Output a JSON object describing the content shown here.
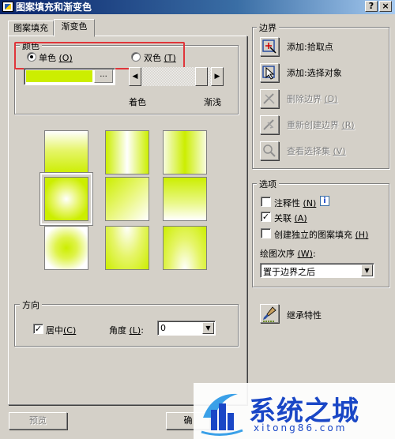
{
  "window": {
    "title": "图案填充和渐变色",
    "help_btn": "?",
    "close_btn": "×"
  },
  "tabs": [
    {
      "label": "图案填充"
    },
    {
      "label": "渐变色"
    }
  ],
  "color_group": {
    "title": "颜色",
    "single_label": "单色",
    "single_key": "(O)",
    "double_label": "双色",
    "double_key": "(T)",
    "swatch_color": "#ccee00",
    "browse_label": "...",
    "shade_label": "着色",
    "tint_label": "渐浅",
    "slider_level_percent": 95
  },
  "gradient_tiles": [
    {
      "name": "gradient-linear-vertical"
    },
    {
      "name": "gradient-cylinder-horizontal"
    },
    {
      "name": "gradient-inverted-cylinder-horizontal"
    },
    {
      "name": "gradient-spherical"
    },
    {
      "name": "gradient-hemispherical"
    },
    {
      "name": "gradient-curved"
    },
    {
      "name": "gradient-spherical-invert"
    },
    {
      "name": "gradient-hemispherical-invert"
    },
    {
      "name": "gradient-curved-invert"
    }
  ],
  "orientation_group": {
    "title": "方向",
    "centered_label": "居中",
    "centered_key": "(C)",
    "angle_label": "角度",
    "angle_key": "(L)",
    "angle_value": "0"
  },
  "boundaries_group": {
    "title": "边界",
    "add_pick_points": "添加:拾取点",
    "add_select_objects": "添加:选择对象",
    "remove_boundaries": "删除边界",
    "remove_boundaries_key": "(D)",
    "recreate_boundary": "重新创建边界",
    "recreate_boundary_key": "(R)",
    "view_selections": "查看选择集",
    "view_selections_key": "(V)"
  },
  "options_group": {
    "title": "选项",
    "annotative": "注释性",
    "annotative_key": "(N)",
    "info_icon": "i",
    "associative": "关联",
    "associative_key": "(A)",
    "separate_hatches": "创建独立的图案填充",
    "separate_hatches_key": "(H)",
    "draw_order_label": "绘图次序",
    "draw_order_key": "(W)",
    "draw_order_value": "置于边界之后"
  },
  "inherit": {
    "label": "继承特性"
  },
  "footer": {
    "preview": "预览",
    "ok_partial": "确"
  },
  "watermark": {
    "text": "系统之城",
    "url": "xitong86.com"
  }
}
